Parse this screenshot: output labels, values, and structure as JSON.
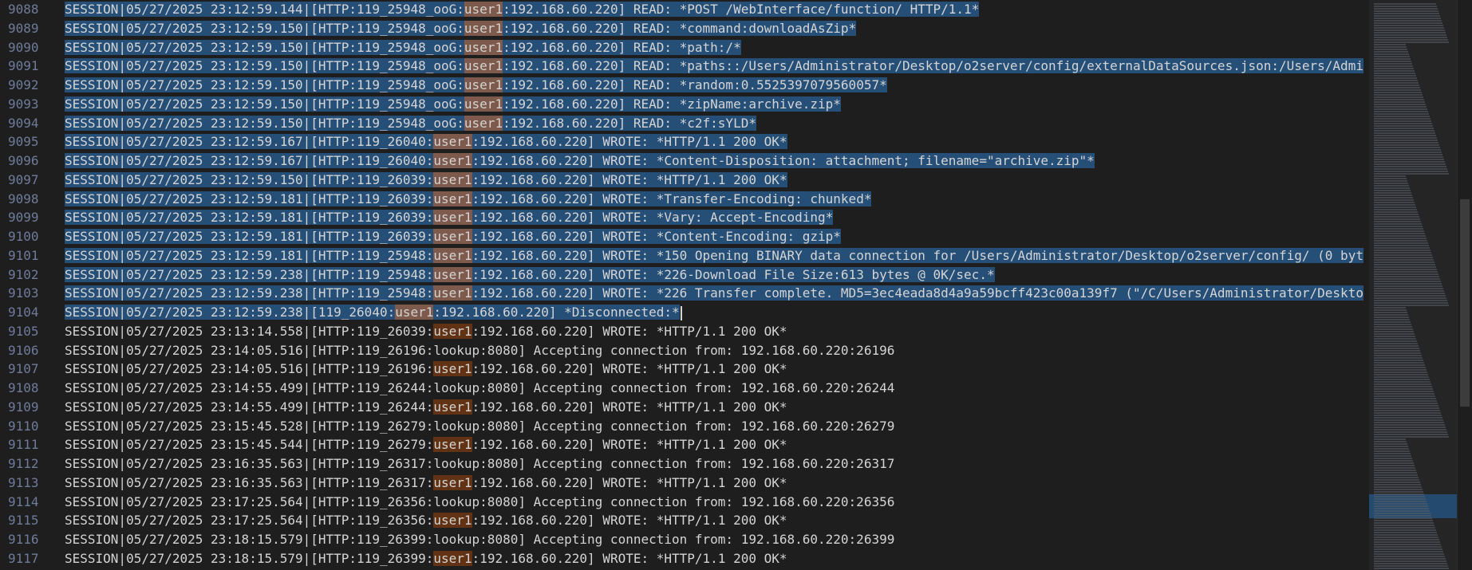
{
  "editor": {
    "lines": [
      {
        "num": "9088",
        "pre": "SESSION|05/27/2025 23:12:59.144|[HTTP:119_25948_ooG:",
        "user": "user1",
        "post": ":192.168.60.220] READ: *POST /WebInterface/function/ HTTP/1.1*",
        "selected": true
      },
      {
        "num": "9089",
        "pre": "SESSION|05/27/2025 23:12:59.150|[HTTP:119_25948_ooG:",
        "user": "user1",
        "post": ":192.168.60.220] READ: *command:downloadAsZip*",
        "selected": true
      },
      {
        "num": "9090",
        "pre": "SESSION|05/27/2025 23:12:59.150|[HTTP:119_25948_ooG:",
        "user": "user1",
        "post": ":192.168.60.220] READ: *path:/*",
        "selected": true
      },
      {
        "num": "9091",
        "pre": "SESSION|05/27/2025 23:12:59.150|[HTTP:119_25948_ooG:",
        "user": "user1",
        "post": ":192.168.60.220] READ: *paths::/Users/Administrator/Desktop/o2server/config/externalDataSources.json:/Users/Admi",
        "selected": true
      },
      {
        "num": "9092",
        "pre": "SESSION|05/27/2025 23:12:59.150|[HTTP:119_25948_ooG:",
        "user": "user1",
        "post": ":192.168.60.220] READ: *random:0.5525397079560057*",
        "selected": true
      },
      {
        "num": "9093",
        "pre": "SESSION|05/27/2025 23:12:59.150|[HTTP:119_25948_ooG:",
        "user": "user1",
        "post": ":192.168.60.220] READ: *zipName:archive.zip*",
        "selected": true
      },
      {
        "num": "9094",
        "pre": "SESSION|05/27/2025 23:12:59.150|[HTTP:119_25948_ooG:",
        "user": "user1",
        "post": ":192.168.60.220] READ: *c2f:sYLD*",
        "selected": true
      },
      {
        "num": "9095",
        "pre": "SESSION|05/27/2025 23:12:59.167|[HTTP:119_26040:",
        "user": "user1",
        "post": ":192.168.60.220] WROTE: *HTTP/1.1 200 OK*",
        "selected": true
      },
      {
        "num": "9096",
        "pre": "SESSION|05/27/2025 23:12:59.167|[HTTP:119_26040:",
        "user": "user1",
        "post": ":192.168.60.220] WROTE: *Content-Disposition: attachment; filename=\"archive.zip\"*",
        "selected": true
      },
      {
        "num": "9097",
        "pre": "SESSION|05/27/2025 23:12:59.150|[HTTP:119_26039:",
        "user": "user1",
        "post": ":192.168.60.220] WROTE: *HTTP/1.1 200 OK*",
        "selected": true
      },
      {
        "num": "9098",
        "pre": "SESSION|05/27/2025 23:12:59.181|[HTTP:119_26039:",
        "user": "user1",
        "post": ":192.168.60.220] WROTE: *Transfer-Encoding: chunked*",
        "selected": true
      },
      {
        "num": "9099",
        "pre": "SESSION|05/27/2025 23:12:59.181|[HTTP:119_26039:",
        "user": "user1",
        "post": ":192.168.60.220] WROTE: *Vary: Accept-Encoding*",
        "selected": true
      },
      {
        "num": "9100",
        "pre": "SESSION|05/27/2025 23:12:59.181|[HTTP:119_26039:",
        "user": "user1",
        "post": ":192.168.60.220] WROTE: *Content-Encoding: gzip*",
        "selected": true
      },
      {
        "num": "9101",
        "pre": "SESSION|05/27/2025 23:12:59.181|[HTTP:119_25948:",
        "user": "user1",
        "post": ":192.168.60.220] WROTE: *150 Opening BINARY data connection for /Users/Administrator/Desktop/o2server/config/ (0 byt",
        "selected": true
      },
      {
        "num": "9102",
        "pre": "SESSION|05/27/2025 23:12:59.238|[HTTP:119_25948:",
        "user": "user1",
        "post": ":192.168.60.220] WROTE: *226-Download File Size:613 bytes @ 0K/sec.*",
        "selected": true
      },
      {
        "num": "9103",
        "pre": "SESSION|05/27/2025 23:12:59.238|[HTTP:119_25948:",
        "user": "user1",
        "post": ":192.168.60.220] WROTE: *226 Transfer complete. MD5=3ec4eada8d4a9a59bcff423c00a139f7 (\"/C/Users/Administrator/Deskto",
        "selected": true
      },
      {
        "num": "9104",
        "pre": "SESSION|05/27/2025 23:12:59.238|[119_26040:",
        "user": "user1",
        "post": ":192.168.60.220] *Disconnected:*",
        "selected": true,
        "caret": true
      },
      {
        "num": "9105",
        "pre": "SESSION|05/27/2025 23:13:14.558|[HTTP:119_26039:",
        "user": "user1",
        "post": ":192.168.60.220] WROTE: *HTTP/1.1 200 OK*",
        "selected": false
      },
      {
        "num": "9106",
        "pre": "SESSION|05/27/2025 23:14:05.516|[HTTP:119_26196:lookup:8080] Accepting connection from: 192.168.60.220:26196",
        "user": "",
        "post": "",
        "selected": false
      },
      {
        "num": "9107",
        "pre": "SESSION|05/27/2025 23:14:05.516|[HTTP:119_26196:",
        "user": "user1",
        "post": ":192.168.60.220] WROTE: *HTTP/1.1 200 OK*",
        "selected": false
      },
      {
        "num": "9108",
        "pre": "SESSION|05/27/2025 23:14:55.499|[HTTP:119_26244:lookup:8080] Accepting connection from: 192.168.60.220:26244",
        "user": "",
        "post": "",
        "selected": false
      },
      {
        "num": "9109",
        "pre": "SESSION|05/27/2025 23:14:55.499|[HTTP:119_26244:",
        "user": "user1",
        "post": ":192.168.60.220] WROTE: *HTTP/1.1 200 OK*",
        "selected": false
      },
      {
        "num": "9110",
        "pre": "SESSION|05/27/2025 23:15:45.528|[HTTP:119_26279:lookup:8080] Accepting connection from: 192.168.60.220:26279",
        "user": "",
        "post": "",
        "selected": false
      },
      {
        "num": "9111",
        "pre": "SESSION|05/27/2025 23:15:45.544|[HTTP:119_26279:",
        "user": "user1",
        "post": ":192.168.60.220] WROTE: *HTTP/1.1 200 OK*",
        "selected": false
      },
      {
        "num": "9112",
        "pre": "SESSION|05/27/2025 23:16:35.563|[HTTP:119_26317:lookup:8080] Accepting connection from: 192.168.60.220:26317",
        "user": "",
        "post": "",
        "selected": false
      },
      {
        "num": "9113",
        "pre": "SESSION|05/27/2025 23:16:35.563|[HTTP:119_26317:",
        "user": "user1",
        "post": ":192.168.60.220] WROTE: *HTTP/1.1 200 OK*",
        "selected": false
      },
      {
        "num": "9114",
        "pre": "SESSION|05/27/2025 23:17:25.564|[HTTP:119_26356:lookup:8080] Accepting connection from: 192.168.60.220:26356",
        "user": "",
        "post": "",
        "selected": false
      },
      {
        "num": "9115",
        "pre": "SESSION|05/27/2025 23:17:25.564|[HTTP:119_26356:",
        "user": "user1",
        "post": ":192.168.60.220] WROTE: *HTTP/1.1 200 OK*",
        "selected": false
      },
      {
        "num": "9116",
        "pre": "SESSION|05/27/2025 23:18:15.579|[HTTP:119_26399:lookup:8080] Accepting connection from: 192.168.60.220:26399",
        "user": "",
        "post": "",
        "selected": false
      },
      {
        "num": "9117",
        "pre": "SESSION|05/27/2025 23:18:15.579|[HTTP:119_26399:",
        "user": "user1",
        "post": ":192.168.60.220] WROTE: *HTTP/1.1 200 OK*",
        "selected": false
      }
    ]
  },
  "colors": {
    "background": "#1e1e1e",
    "selection": "#264f78",
    "match_highlight": "#613214",
    "line_number": "#6e7b9a"
  }
}
